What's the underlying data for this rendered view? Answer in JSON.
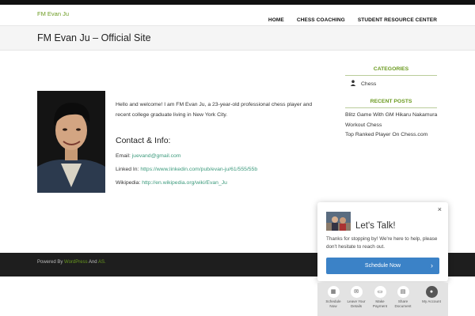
{
  "site": {
    "title": "FM Evan Ju"
  },
  "nav": {
    "items": [
      "HOME",
      "CHESS COACHING",
      "STUDENT RESOURCE CENTER"
    ]
  },
  "page": {
    "title": "FM Evan Ju – Official Site"
  },
  "content": {
    "intro": "Hello and welcome! I am FM Evan Ju, a 23-year-old professional chess player and recent college graduate living in New York City.",
    "contact_heading": "Contact & Info:",
    "email_label": "Email:",
    "email_value": "juevand@gmail.com",
    "linkedin_label": "Linked In:",
    "linkedin_value": "https://www.linkedin.com/pub/evan-ju/61/555/55b",
    "wiki_label": "Wikipedia:",
    "wiki_value": "http://en.wikipedia.org/wiki/Evan_Ju"
  },
  "sidebar": {
    "categories_title": "CATEGORIES",
    "categories": [
      "Chess"
    ],
    "recent_title": "RECENT POSTS",
    "posts": [
      "Blitz Game With GM Hikaru Nakamura",
      "Workout Chess",
      "Top Ranked Player On Chess.com"
    ]
  },
  "footer": {
    "powered_by": "Powered By",
    "wordpress": "WordPress",
    "and": "And",
    "as": "AS."
  },
  "chat": {
    "title": "Let's Talk!",
    "text": "Thanks for stopping by! We're here to help, please don't hesitate to reach out.",
    "button": "Schedule Now",
    "close": "×",
    "bar": [
      {
        "label1": "Schedule",
        "label2": "Now",
        "icon": "calendar-icon"
      },
      {
        "label1": "Leave Your",
        "label2": "Details",
        "icon": "mail-icon"
      },
      {
        "label1": "Make",
        "label2": "Payment",
        "icon": "card-icon"
      },
      {
        "label1": "Share",
        "label2": "Document",
        "icon": "document-icon"
      },
      {
        "label1": "My Account",
        "label2": "",
        "icon": "user-icon"
      }
    ]
  },
  "colors": {
    "accent_green": "#6a9a1f",
    "link_teal": "#3c9a7c",
    "button_blue": "#3b82c7",
    "footer_bg": "#1e1e1e"
  }
}
